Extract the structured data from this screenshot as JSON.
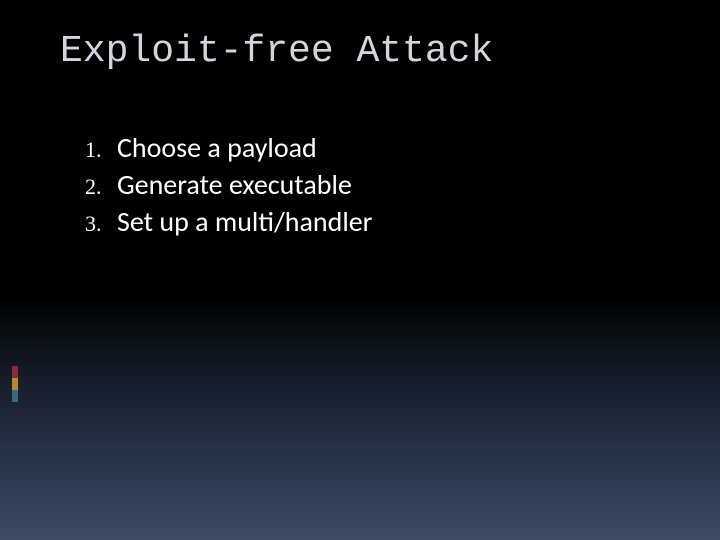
{
  "slide": {
    "title": "Exploit-free Attack",
    "items": [
      {
        "num": "1.",
        "text": "Choose a payload"
      },
      {
        "num": "2.",
        "text": "Generate executable"
      },
      {
        "num": "3.",
        "text": "Set up a multi/handler"
      }
    ]
  }
}
